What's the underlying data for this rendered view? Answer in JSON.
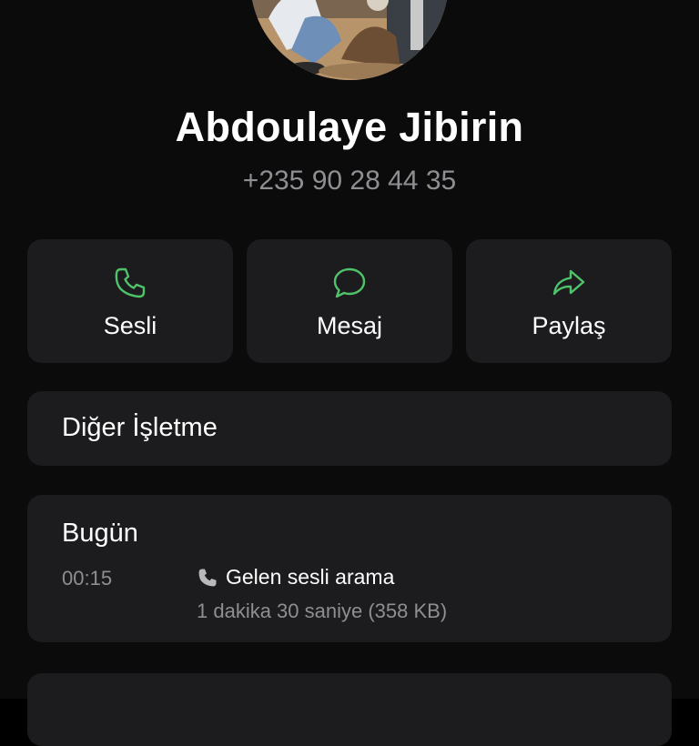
{
  "contact": {
    "name": "Abdoulaye Jibirin",
    "phone": "+235 90 28 44 35"
  },
  "actions": [
    {
      "label": "Sesli",
      "icon": "phone-icon"
    },
    {
      "label": "Mesaj",
      "icon": "message-icon"
    },
    {
      "label": "Paylaş",
      "icon": "share-icon"
    }
  ],
  "business": {
    "label": "Diğer İşletme"
  },
  "calls": {
    "date": "Bugün",
    "entries": [
      {
        "time": "00:15",
        "type": "Gelen sesli arama",
        "detail": "1 dakika 30 saniye (358 KB)",
        "icon": "phone-icon"
      }
    ]
  },
  "colors": {
    "background": "#0b0b0b",
    "card": "#1c1c1e",
    "accent": "#4fc36a",
    "secondary_text": "#8e8e93",
    "primary_text": "#ffffff"
  }
}
